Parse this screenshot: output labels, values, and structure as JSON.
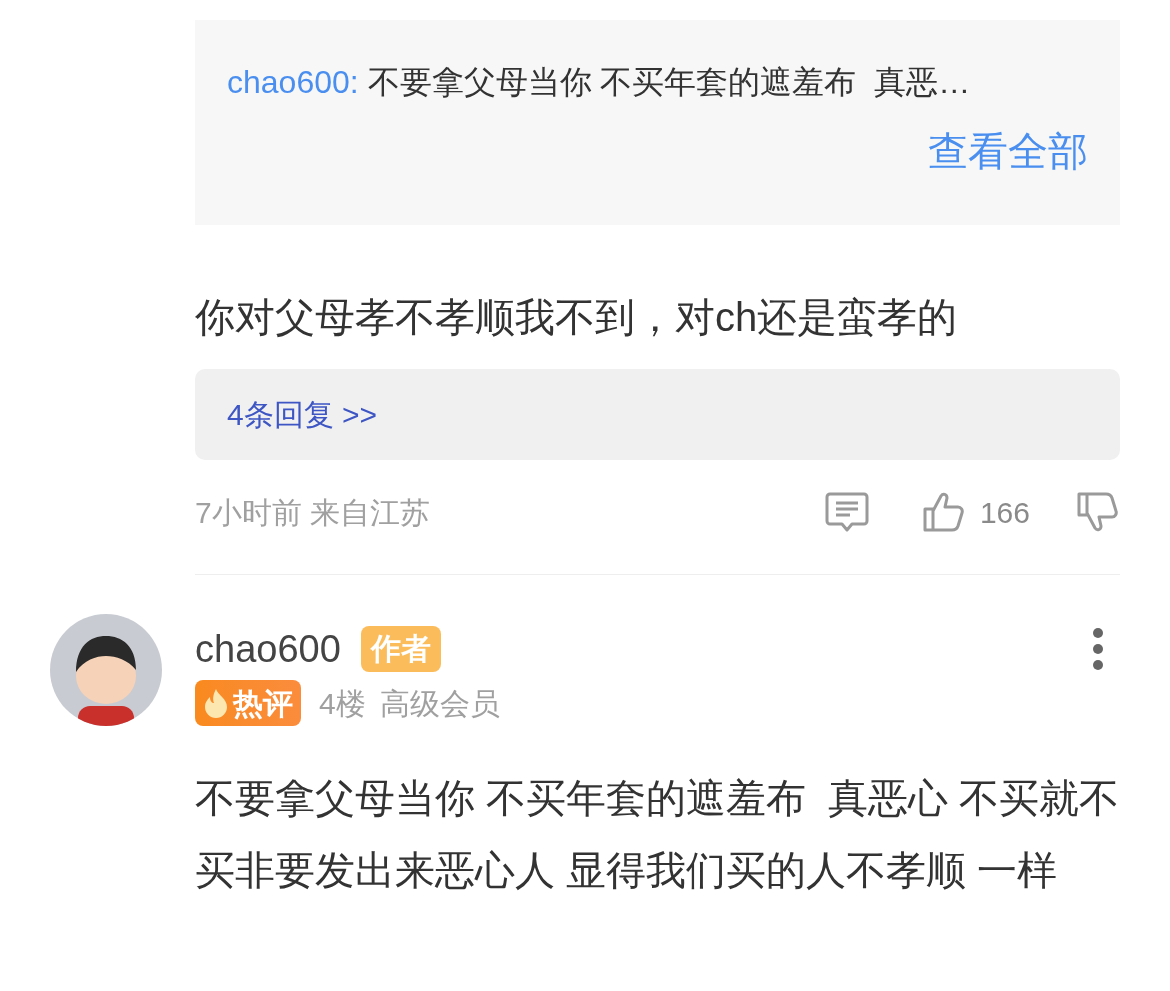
{
  "quoted_reply": {
    "author": "chao600:",
    "text": "不要拿父母当你 不买年套的遮羞布  真恶…",
    "view_all": "查看全部"
  },
  "comment": {
    "text": "你对父母孝不孝顺我不到，对ch还是蛮孝的",
    "replies_link": "4条回复 >>",
    "time": "7小时前 来自江苏",
    "likes": "166"
  },
  "next_comment": {
    "author": "chao600",
    "author_badge": "作者",
    "hot_badge": "热评",
    "floor": "4楼",
    "level": "高级会员",
    "text": "不要拿父母当你 不买年套的遮羞布  真恶心 不买就不买非要发出来恶心人 显得我们买的人不孝顺 一样"
  }
}
